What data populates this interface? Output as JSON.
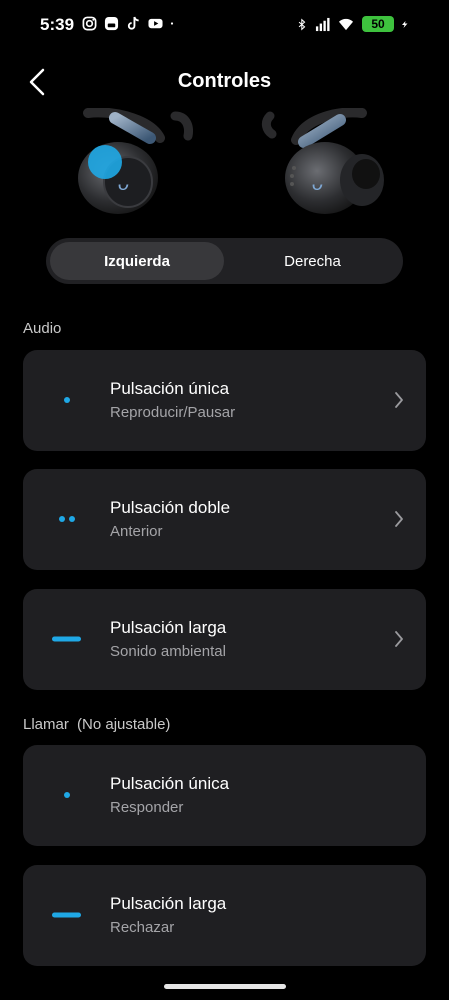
{
  "status_bar": {
    "time": "5:39",
    "battery_level": "50",
    "battery_color": "#3ec23e",
    "left_icons": [
      "instagram-icon",
      "messages-icon",
      "tiktok-icon",
      "youtube-icon",
      "dot-icon"
    ],
    "right_icons": [
      "bluetooth-icon",
      "signal-icon",
      "wifi-icon",
      "battery-icon",
      "charging-icon"
    ]
  },
  "header": {
    "title": "Controles"
  },
  "earbuds_image": {
    "selected_side": "left",
    "accent_color": "#1fa8e6"
  },
  "tabs": [
    {
      "label": "Izquierda",
      "selected": true
    },
    {
      "label": "Derecha",
      "selected": false
    }
  ],
  "audio_section": {
    "label": "Audio",
    "items": [
      {
        "title": "Pulsación única",
        "subtitle": "Reproducir/Pausar",
        "indicator": "single-dot-icon"
      },
      {
        "title": "Pulsación doble",
        "subtitle": "Anterior",
        "indicator": "double-dot-icon"
      },
      {
        "title": "Pulsación larga",
        "subtitle": "Sonido ambiental",
        "indicator": "long-press-bar-icon"
      }
    ]
  },
  "call_section": {
    "label": "Llamar",
    "note": "(No ajustable)",
    "items": [
      {
        "title": "Pulsación única",
        "subtitle": "Responder",
        "indicator": "single-dot-icon"
      },
      {
        "title": "Pulsación larga",
        "subtitle": "Rechazar",
        "indicator": "long-press-bar-icon"
      }
    ]
  },
  "colors": {
    "accent": "#1fa8e6",
    "card_bg": "#1f1f22",
    "background": "#000000"
  }
}
